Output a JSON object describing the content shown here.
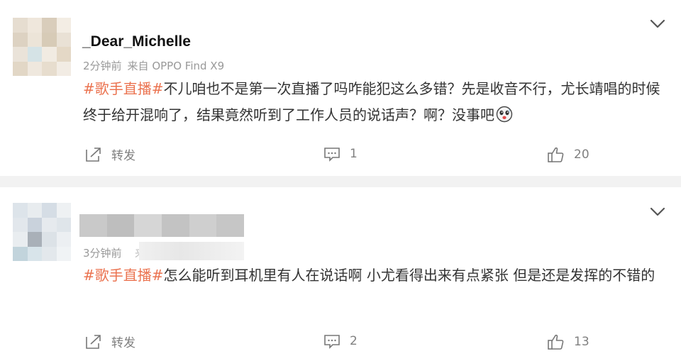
{
  "posts": [
    {
      "username": "_Dear_Michelle",
      "time": "2分钟前",
      "source": "来自 OPPO Find X9",
      "topic": "#歌手直播#",
      "text": "不儿咱也不是第一次直播了吗咋能犯这么多错？先是收音不行，尤长靖唱的时候终于给开混响了，结果竟然听到了工作人员的说话声？啊？没事吧",
      "repost_label": "转发",
      "comment_count": "1",
      "like_count": "20"
    },
    {
      "username": "",
      "time": "3分钟前",
      "source_partial": "来",
      "topic": "#歌手直播#",
      "text": "怎么能听到耳机里有人在说话啊 小尤看得出来有点紧张 但是还是发挥的不错的",
      "repost_label": "转发",
      "comment_count": "2",
      "like_count": "13"
    }
  ],
  "colors": {
    "topic": "#eb7350",
    "meta": "#999999",
    "divider": "#f2f2f2",
    "action": "#808080"
  },
  "icons": [
    "chevron-down-icon",
    "repost-icon",
    "comment-icon",
    "like-icon",
    "emoji-icon"
  ]
}
